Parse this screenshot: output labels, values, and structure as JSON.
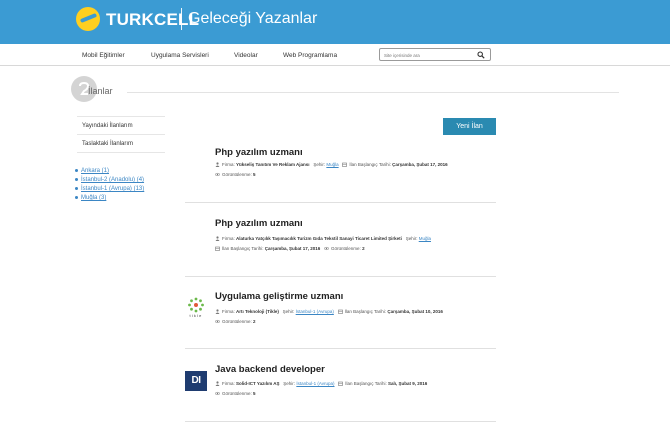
{
  "header": {
    "brand": "TURKCELL",
    "subtitle": "Geleceği Yazanlar",
    "colors": {
      "topbar": "#3b9bd3",
      "logo": "#ffcf1f"
    }
  },
  "nav": {
    "items": [
      "Mobil Eğitimler",
      "Uygulama Servisleri",
      "Videolar",
      "Web Programlama"
    ],
    "search_placeholder": "Site içerisinde ara"
  },
  "page": {
    "title": "İlanlar"
  },
  "sidebar": {
    "links": [
      "Yayındaki İlanlarım",
      "Taslaktaki İlanlarım"
    ],
    "filters": [
      "Ankara (1)",
      "İstanbul-2 (Anadolu) (4)",
      "İstanbul-1 (Avrupa) (13)",
      "Muğla (3)"
    ]
  },
  "actions": {
    "new_label": "Yeni İlan",
    "color": "#2a8ab1"
  },
  "labels": {
    "firma": "Firma:",
    "sehir": "Şehir:",
    "tarih": "İlan Başlangıç Tarihi:",
    "goruntulenme": "Görüntülenme:"
  },
  "listings": [
    {
      "title": "Php yazılım uzmanı",
      "company": "Yükseliş Tanıtım Ve Reklam Ajansı",
      "city": "Muğla",
      "date": "Çarşamba, Şubat 17, 2016",
      "views": "5",
      "logo": "none"
    },
    {
      "title": "Php yazılım uzmanı",
      "company": "Alaturka Yatçılık Taşımacılık Turizm Gıda Tekstil Sanayi Ticaret Limited Şirketi",
      "city": "Muğla",
      "date": "Çarşamba, Şubat 17, 2016",
      "views": "2",
      "logo": "none"
    },
    {
      "title": "Uygulama geliştirme uzmanı",
      "company": "Artı Teknoloji (Tikle)",
      "city": "İstanbul-1 (Avrupa)",
      "date": "Çarşamba, Şubat 10, 2016",
      "views": "2",
      "logo": "tikle-logo",
      "logo_text": "tikle"
    },
    {
      "title": "Java backend developer",
      "company": "Solid-ICT Yazılım AŞ",
      "city": "İstanbul-1 (Avrupa)",
      "date": "Salı, Şubat 9, 2016",
      "views": "5",
      "logo": "di-logo",
      "logo_text": "DI"
    }
  ]
}
